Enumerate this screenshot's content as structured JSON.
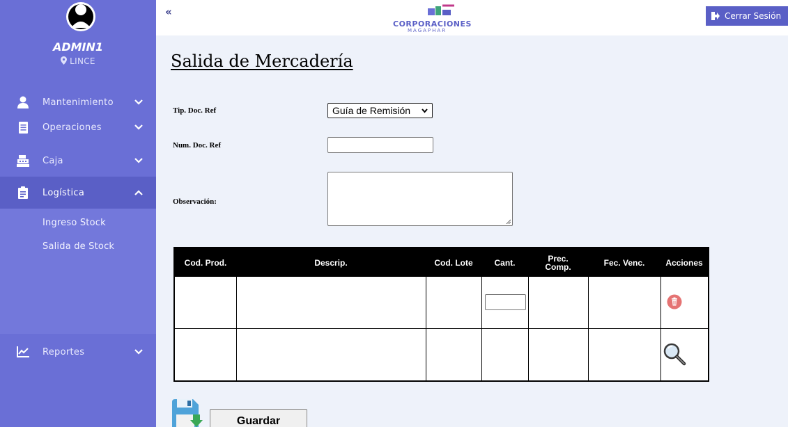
{
  "sidebar": {
    "user_name": "ADMIN1",
    "location": "LINCE",
    "menu": [
      {
        "label": "Mantenimiento",
        "icon": "user-icon"
      },
      {
        "label": "Operaciones",
        "icon": "document-icon"
      },
      {
        "label": "Caja",
        "icon": "cash-register-icon"
      },
      {
        "label": "Logística",
        "icon": "clipboard-icon"
      },
      {
        "label": "Reportes",
        "icon": "chart-line-icon"
      }
    ],
    "submenu": [
      {
        "label": "Ingreso Stock"
      },
      {
        "label": "Salida de Stock"
      }
    ]
  },
  "topbar": {
    "collapse": "«",
    "logo_text": "CORPORACIONES",
    "logo_sub": "MAGAPHAR",
    "logout_label": "Cerrar Sesión"
  },
  "page": {
    "title": "Salida de Mercadería"
  },
  "form": {
    "tip_doc_label": "Tip. Doc. Ref",
    "tip_doc_value": "Guía de Remisión",
    "num_doc_label": "Num. Doc. Ref",
    "num_doc_value": "",
    "obs_label": "Observación:",
    "obs_value": ""
  },
  "table": {
    "headers": [
      "Cod. Prod.",
      "Descrip.",
      "Cod. Lote",
      "Cant.",
      "Prec.\nComp.",
      "Fec. Venc.",
      "Acciones"
    ]
  },
  "save_label": "Guardar",
  "colors": {
    "sidebar": "#6a6fd6",
    "sidebar_active": "#5a5fc6",
    "submenu": "#7378db",
    "background": "#eef2fa",
    "table_header": "#000000"
  }
}
